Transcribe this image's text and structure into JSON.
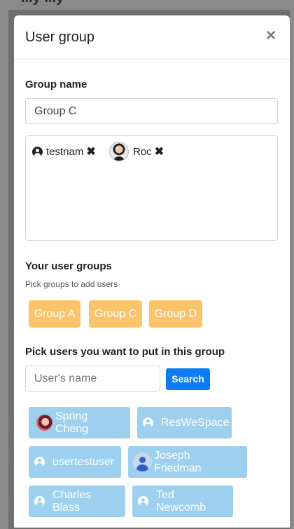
{
  "backdrop": {
    "partial_text": "...y ...y"
  },
  "modal": {
    "title": "User group",
    "close_glyph": "×"
  },
  "group_name": {
    "label": "Group name",
    "value": "Group C"
  },
  "members": [
    {
      "name": "testnam",
      "icon": "user-circle-icon",
      "remove_glyph": "✖"
    },
    {
      "name": "Roc",
      "icon": "avatar-photo",
      "remove_glyph": "✖"
    }
  ],
  "your_groups": {
    "title": "Your user groups",
    "hint": "Pick groups to add users",
    "groups": [
      "Group A",
      "Group C",
      "Group D"
    ],
    "color": "#fcc46a"
  },
  "pick_users": {
    "title": "Pick users you want to put in this group",
    "search_placeholder": "User's name",
    "search_button": "Search",
    "button_color": "#0d7cf2",
    "users": [
      {
        "name": "Spring Cheng",
        "icon": "avatar-photo"
      },
      {
        "name": "ResWeSpace",
        "icon": "user-circle-icon"
      },
      {
        "name": "usertestuser",
        "icon": "user-circle-icon"
      },
      {
        "name": "Joseph Friedman",
        "icon": "avatar-default"
      },
      {
        "name": "Charles Blass",
        "icon": "user-circle-icon"
      },
      {
        "name": "Ted Newcomb",
        "icon": "user-circle-icon"
      }
    ],
    "user_color": "#9cd0ee"
  }
}
